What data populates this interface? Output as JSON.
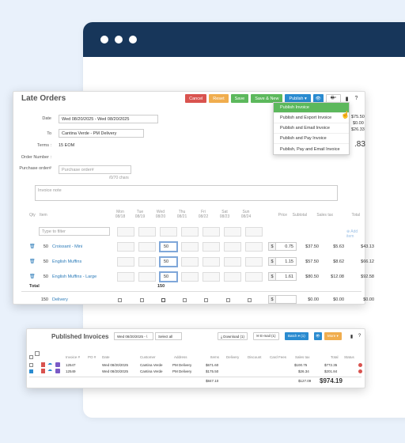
{
  "order": {
    "title": "Late Orders",
    "toolbar": {
      "cancel": "Cancel",
      "reset": "Reset",
      "save": "Save",
      "save_new": "Save & New",
      "publish": "Publish ▾",
      "print": "🖶▾"
    },
    "publish_menu": [
      "Publish Invoice",
      "Publish and Export Invoice",
      "Publish and Email Invoice",
      "Publish and Pay Invoice",
      "Publish, Pay and Email Invoice"
    ],
    "form": {
      "date_label": "Date",
      "date_value": "Wed 08/20/2025 - Wed 08/20/2025",
      "to_label": "To",
      "to_value": "Cantina Verde - PM Delivery",
      "terms_label": "Terms :",
      "terms_value": "15 EOM",
      "order_number_label": "Order Number :",
      "po_label": "Purchase order#",
      "po_placeholder": "Purchase order#",
      "chars": "/0/70 chars",
      "note_placeholder": "Invoice note"
    },
    "right_totals": [
      "$75.50",
      "$0.00",
      "$26.33",
      ".83"
    ],
    "columns": {
      "qty": "Qty",
      "item": "Item",
      "days": [
        {
          "d": "Mon",
          "date": "08/18"
        },
        {
          "d": "Tue",
          "date": "08/19"
        },
        {
          "d": "Wed",
          "date": "08/20"
        },
        {
          "d": "Thu",
          "date": "08/21"
        },
        {
          "d": "Fri",
          "date": "08/22"
        },
        {
          "d": "Sat",
          "date": "08/23"
        },
        {
          "d": "Sun",
          "date": "08/24"
        }
      ],
      "price": "Price",
      "subtotal": "Subtotal",
      "sales_tax": "Sales tax",
      "total": "Total"
    },
    "filter_placeholder": "Type to filter",
    "add_item": "⊕ Add item",
    "rows": [
      {
        "qty": "50",
        "item": "Croissant - Mini",
        "wed": "50",
        "price": "0.75",
        "subtotal": "$37.50",
        "tax": "$5.63",
        "total": "$43.13"
      },
      {
        "qty": "50",
        "item": "English Muffins",
        "wed": "50",
        "price": "1.15",
        "subtotal": "$57.50",
        "tax": "$8.62",
        "total": "$66.12"
      },
      {
        "qty": "50",
        "item": "English Muffins - Large",
        "wed": "50",
        "price": "1.61",
        "subtotal": "$80.50",
        "tax": "$12.08",
        "total": "$92.58"
      }
    ],
    "total_label": "Total",
    "total_wed": "150",
    "delivery": {
      "qty": "150",
      "item": "Delivery",
      "subtotal": "$0.00",
      "tax": "$0.00",
      "total": "$0.00"
    }
  },
  "published": {
    "title": "Published Invoices",
    "date_range": "Wed 08/20/2025 - \\",
    "select_all": "Select all",
    "download": "⤓ Download (1)",
    "email": "✉ E-mail (1)",
    "batch": "Batch ▾ (1)",
    "more": "More ▾",
    "headers": [
      "Invoice #",
      "PO #",
      "Date",
      "Customer",
      "Address",
      "Items",
      "Delivery",
      "Discount",
      "Card Fees",
      "Sales tax",
      "Total",
      "Status"
    ],
    "rows": [
      {
        "inv": "12547",
        "date": "Wed 08/20/2025",
        "customer": "Cantina Verde",
        "address": "PM Delivery",
        "items": "$671.60",
        "tax": "$100.75",
        "total": "$772.35"
      },
      {
        "inv": "12549",
        "date": "Wed 08/20/2025",
        "customer": "Cantina Verde",
        "address": "PM Delivery",
        "items": "$175.50",
        "tax": "$26.34",
        "total": "$201.84"
      }
    ],
    "sum_items": "$847.10",
    "sum_tax": "$127.09",
    "sum_total": "$974.19"
  },
  "colors": {
    "navy": "#17365a",
    "green": "#5cb85c",
    "blue": "#2a8bd0",
    "red": "#d9534f",
    "orange": "#f0ad4e"
  }
}
